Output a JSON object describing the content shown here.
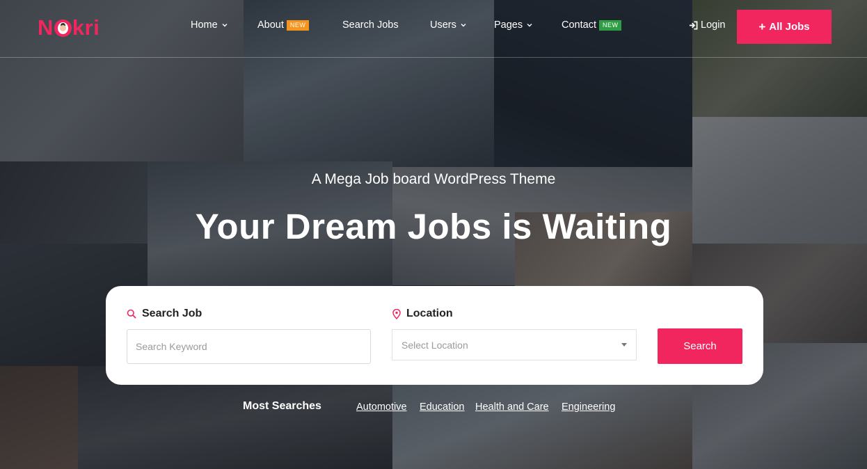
{
  "brand": {
    "logo_left": "N",
    "logo_right": "kri",
    "accent_color": "#f2265f",
    "badge_new_orange": "#f7941d",
    "badge_new_green": "#2e9e44"
  },
  "nav": {
    "items": [
      {
        "label": "Home",
        "has_dropdown": true
      },
      {
        "label": "About",
        "badge": "NEW"
      },
      {
        "label": "Search Jobs"
      },
      {
        "label": "Users",
        "has_dropdown": true
      },
      {
        "label": "Pages",
        "has_dropdown": true
      },
      {
        "label": "Contact",
        "badge": "NEW"
      }
    ],
    "login_label": "Login",
    "login_icon": "sign-in-icon",
    "all_jobs_label": "All Jobs",
    "all_jobs_icon": "plus-icon"
  },
  "hero": {
    "subtitle": "A Mega Job board WordPress Theme",
    "title": "Your Dream Jobs is Waiting"
  },
  "search": {
    "keyword_label": "Search Job",
    "keyword_icon": "search-icon",
    "keyword_placeholder": "Search Keyword",
    "location_label": "Location",
    "location_icon": "map-pin-icon",
    "location_placeholder": "Select Location",
    "submit_label": "Search"
  },
  "most_searches": {
    "label": "Most Searches",
    "tags": [
      "Automotive",
      "Education",
      "Health and Care",
      "Engineering"
    ]
  }
}
